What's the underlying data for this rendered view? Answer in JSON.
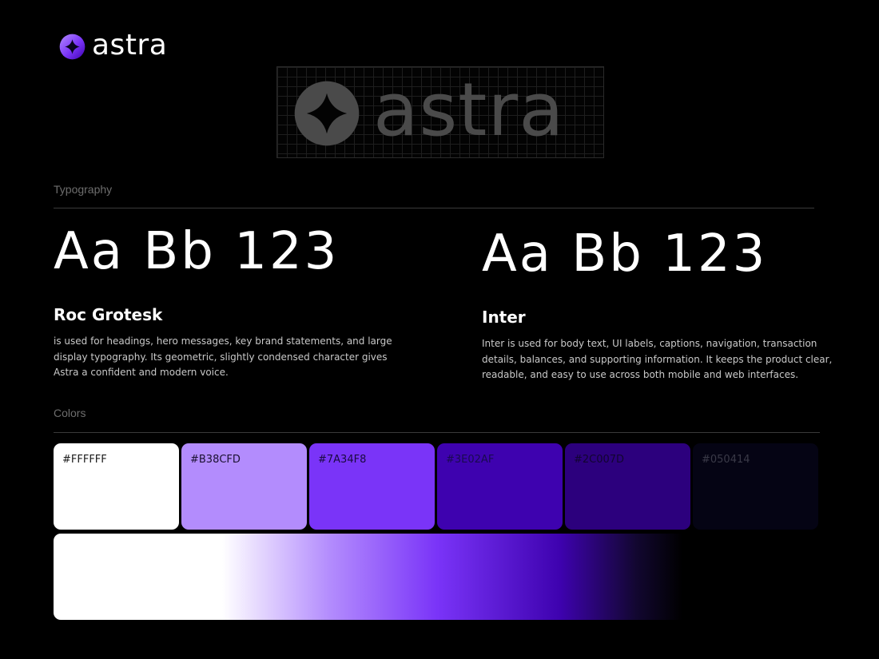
{
  "brand": {
    "name": "astra",
    "mark_colors": [
      "#B38CFD",
      "#7A34F8",
      "#3E02AF"
    ],
    "grid_logo_color": "#4a4a4a"
  },
  "typography": {
    "section_label": "Typography",
    "fonts": [
      {
        "specimen": "Aa Bb 123",
        "name": "Roc Grotesk",
        "description": "is used for headings, hero messages, key brand statements, and large display typography. Its geometric, slightly condensed character gives Astra a confident and modern voice."
      },
      {
        "specimen": "Aa Bb 123",
        "name": "Inter",
        "description": "Inter is used for body text, UI labels, captions, navigation, transaction details, balances, and supporting information. It keeps the product clear, readable, and easy to use across both mobile and web interfaces."
      }
    ]
  },
  "colors": {
    "section_label": "Colors",
    "swatches": [
      {
        "hex": "#FFFFFF",
        "text_color": "#1a1a1a"
      },
      {
        "hex": "#B38CFD",
        "text_color": "#1a1030"
      },
      {
        "hex": "#7A34F8",
        "text_color": "#1a0a40"
      },
      {
        "hex": "#3E02AF",
        "text_color": "#1a0a50"
      },
      {
        "hex": "#2C007D",
        "text_color": "#120530"
      },
      {
        "hex": "#050414",
        "text_color": "#3a3a48"
      }
    ]
  }
}
